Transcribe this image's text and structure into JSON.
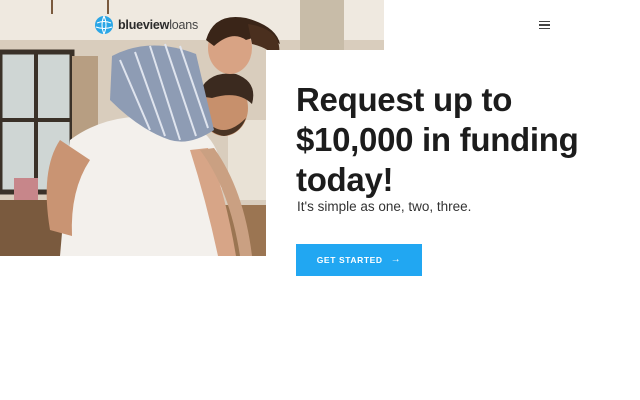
{
  "header": {
    "logo_bold": "blueview",
    "logo_light": "loans",
    "menu_icon": "hamburger-menu-icon"
  },
  "hero": {
    "headline_lines": [
      "Request up to",
      "$10,000 in funding",
      "today!"
    ],
    "subtitle": "It's simple as one, two, three.",
    "cta_label": "GET STARTED",
    "cta_icon": "arrow-right-icon"
  },
  "colors": {
    "accent": "#21a7f2",
    "headline": "#1c1c1c",
    "logo_mark": "#2aa6e6"
  }
}
